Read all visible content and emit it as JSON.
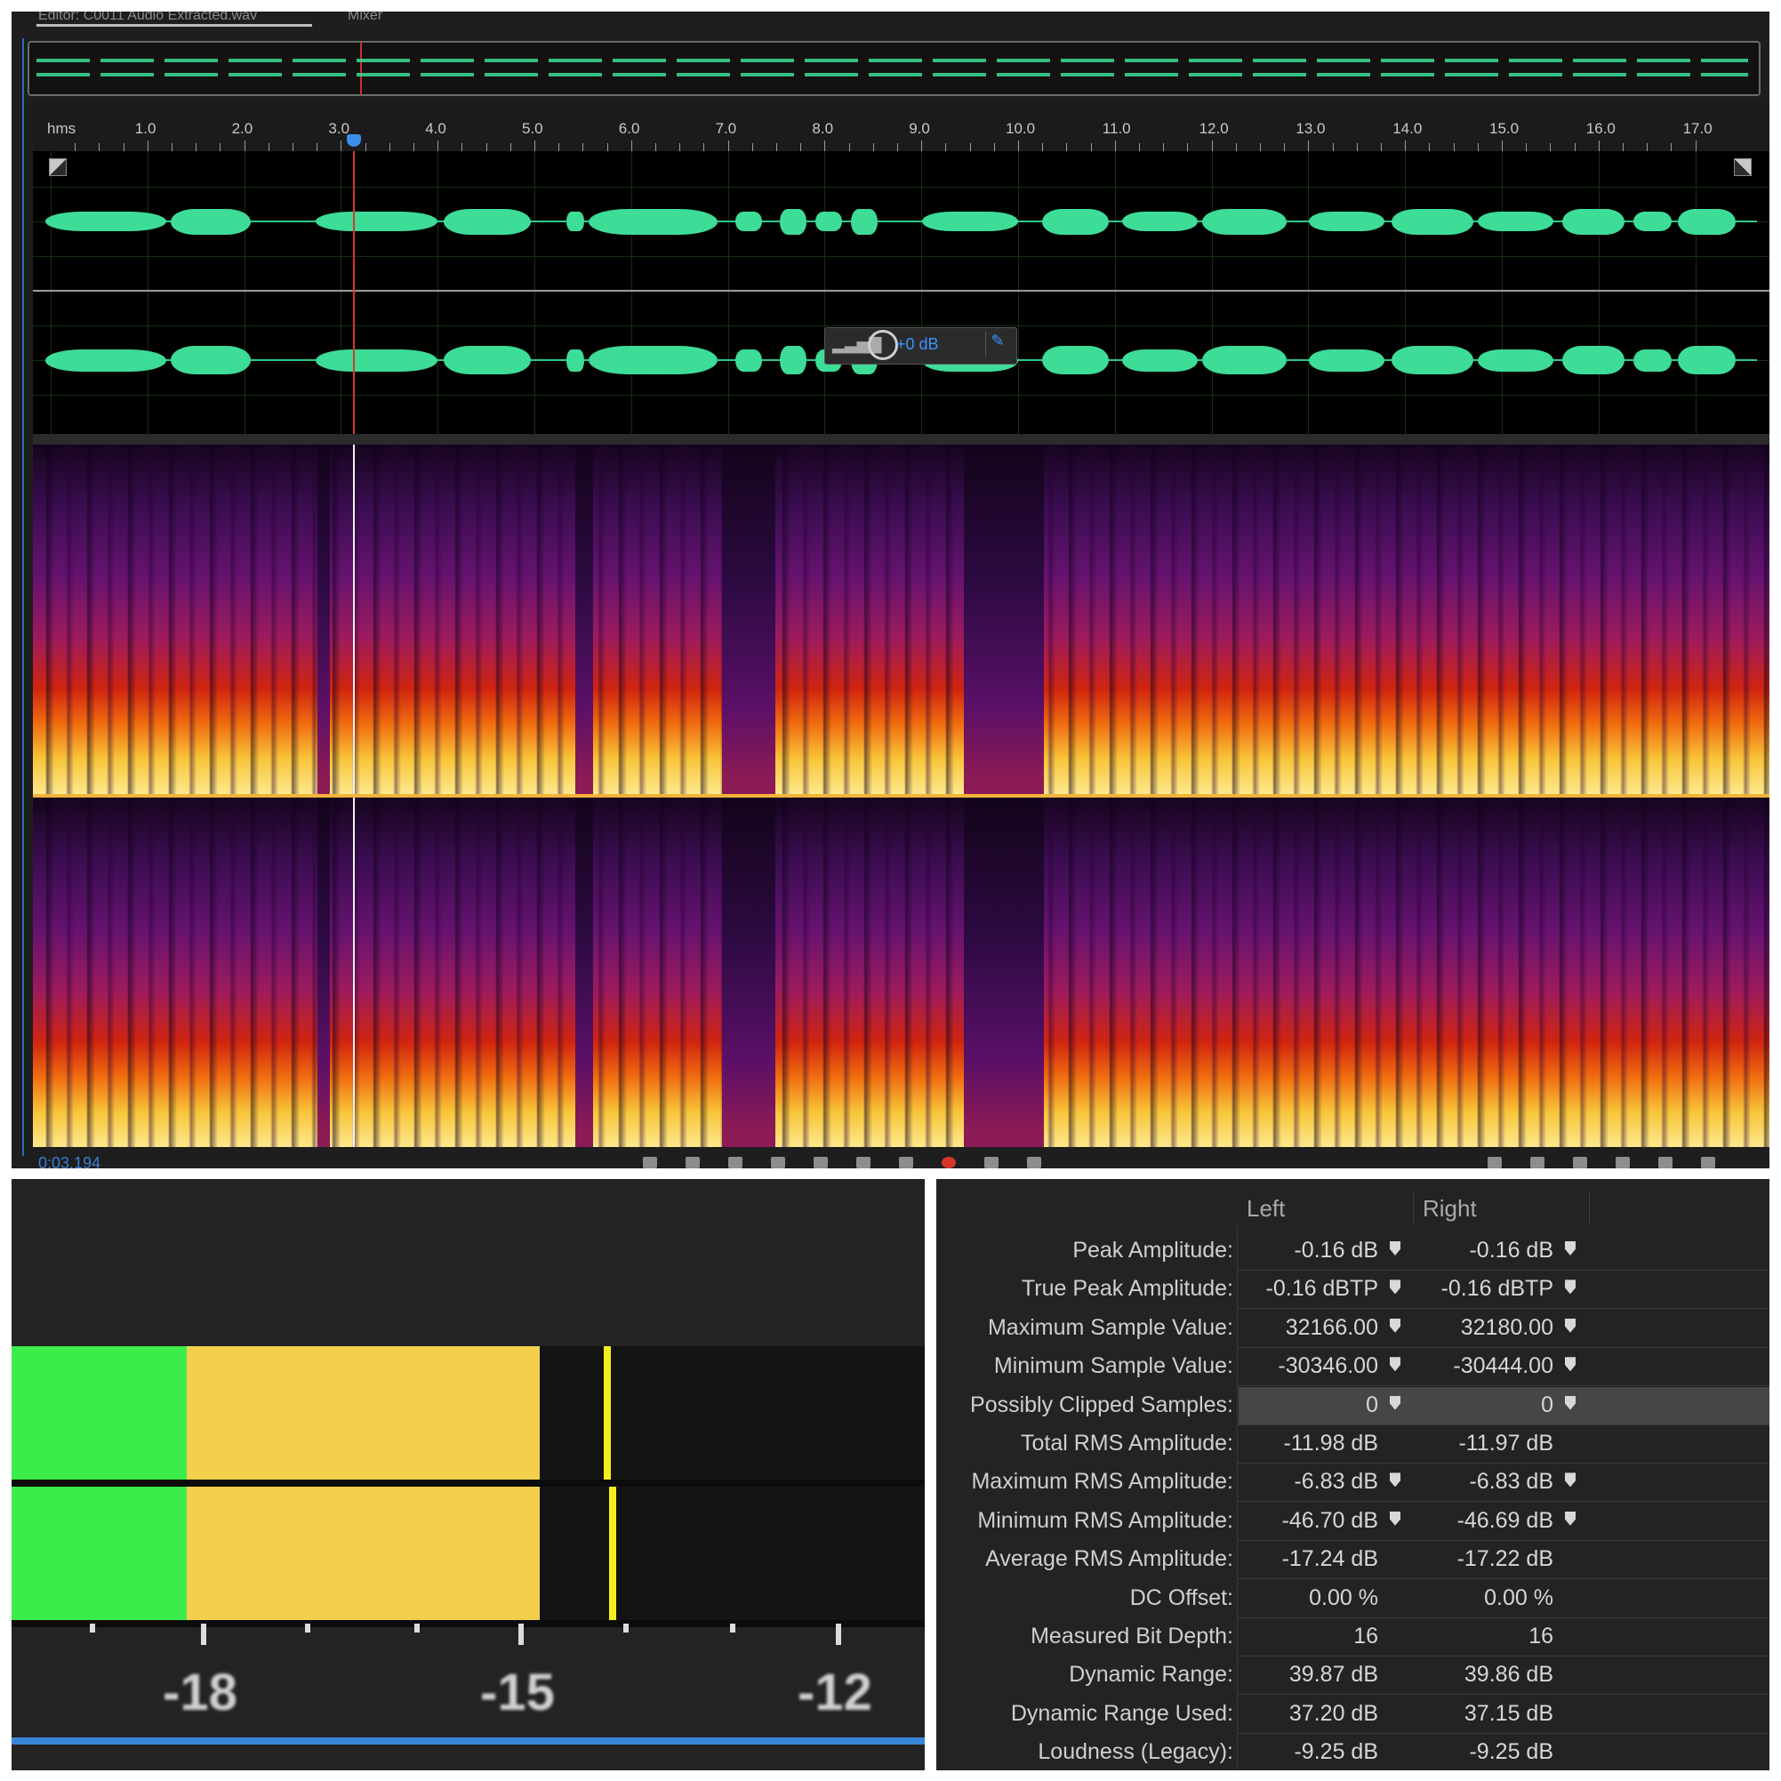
{
  "editor": {
    "tabs": [
      "Editor: C0011 Audio Extracted.wav",
      "Mixer"
    ],
    "ruler_unit": "hms",
    "ruler_labels": [
      "1.0",
      "2.0",
      "3.0",
      "4.0",
      "5.0",
      "6.0",
      "7.0",
      "8.0",
      "9.0",
      "10.0",
      "11.0",
      "12.0",
      "13.0",
      "14.0",
      "15.0",
      "16.0",
      "17.0"
    ],
    "hud_gain": "+0 dB",
    "timecode": "0:03.194",
    "colors": {
      "waveform": "#3ddc97",
      "playhead": "#d8352b",
      "accent": "#3a94ff"
    }
  },
  "meter": {
    "scale_labels": [
      "-18",
      "-15",
      "-12"
    ],
    "colors": {
      "green": "#3cec4b",
      "yellow": "#f2d04c",
      "peak": "#f4ee1e"
    }
  },
  "stats": {
    "columns": {
      "left": "Left",
      "right": "Right"
    },
    "rows": [
      {
        "label": "Peak Amplitude:",
        "left": "-0.16 dB",
        "right": "-0.16 dB",
        "pin": true
      },
      {
        "label": "True Peak Amplitude:",
        "left": "-0.16 dBTP",
        "right": "-0.16 dBTP",
        "pin": true
      },
      {
        "label": "Maximum Sample Value:",
        "left": "32166.00",
        "right": "32180.00",
        "pin": true
      },
      {
        "label": "Minimum Sample Value:",
        "left": "-30346.00",
        "right": "-30444.00",
        "pin": true
      },
      {
        "label": "Possibly Clipped Samples:",
        "left": "0",
        "right": "0",
        "pin": true,
        "highlight": true
      },
      {
        "label": "Total RMS Amplitude:",
        "left": "-11.98 dB",
        "right": "-11.97 dB",
        "pin": false
      },
      {
        "label": "Maximum RMS Amplitude:",
        "left": "-6.83 dB",
        "right": "-6.83 dB",
        "pin": true
      },
      {
        "label": "Minimum RMS Amplitude:",
        "left": "-46.70 dB",
        "right": "-46.69 dB",
        "pin": true
      },
      {
        "label": "Average RMS Amplitude:",
        "left": "-17.24 dB",
        "right": "-17.22 dB",
        "pin": false
      },
      {
        "label": "DC Offset:",
        "left": "0.00 %",
        "right": "0.00 %",
        "pin": false
      },
      {
        "label": "Measured Bit Depth:",
        "left": "16",
        "right": "16",
        "pin": false
      },
      {
        "label": "Dynamic Range:",
        "left": "39.87 dB",
        "right": "39.86 dB",
        "pin": false
      },
      {
        "label": "Dynamic Range Used:",
        "left": "37.20 dB",
        "right": "37.15 dB",
        "pin": false
      },
      {
        "label": "Loudness (Legacy):",
        "left": "-9.25 dB",
        "right": "-9.25 dB",
        "pin": false
      }
    ]
  }
}
